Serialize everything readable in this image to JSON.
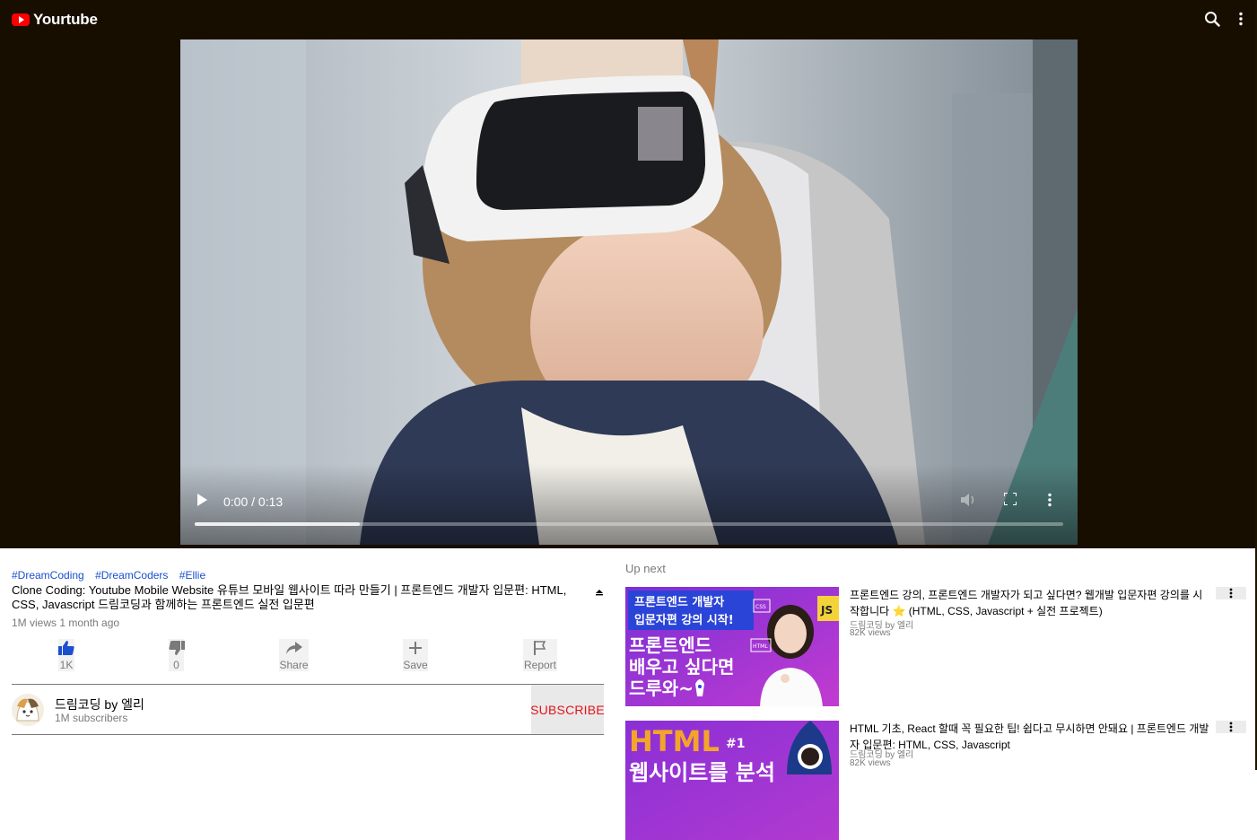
{
  "header": {
    "app_title": "Yourtube",
    "logo_icon": "youtube-play-icon",
    "search_icon": "search-icon",
    "menu_icon": "more-vert-icon",
    "background": "#180e00"
  },
  "player": {
    "time_display": "0:00 / 0:13",
    "progress": 0.19,
    "icons": [
      "play-icon",
      "volume-icon",
      "fullscreen-icon",
      "more-vert-icon"
    ]
  },
  "video_info": {
    "tags": [
      "#DreamCoding",
      "#DreamCoders",
      "#Ellie"
    ],
    "title": "Clone Coding: Youtube Mobile Website 유튜브 모바일 웹사이트 따라 만들기 | 프론트엔드 개발자 입문편: HTML, CSS, Javascript 드림코딩과 함께하는 프론트엔드 실전 입문편",
    "meta": "1M views 1 month ago"
  },
  "actions": {
    "like": "1K",
    "dislike": "0",
    "share": "Share",
    "save": "Save",
    "report": "Report",
    "like_color": "#1a4fd0"
  },
  "channel": {
    "name": "드림코딩 by 엘리",
    "subscribers": "1M subscribers",
    "subscribe_label": "SUBSCRIBE",
    "subscribe_color": "#e2141a"
  },
  "up_next": {
    "heading": "Up next",
    "items": [
      {
        "title": "프론트엔드 강의, 프론트엔드 개발자가 되고 싶다면? 웹개발 입문자편 강의를 시작합니다 ⭐️ (HTML, CSS, Javascript + 실전 프로젝트)",
        "channel": "드림코딩 by 엘리",
        "views": "82K views",
        "thumb_text": {
          "line1": "프론트엔드 개발자",
          "line2": "입문자편 강의 시작!",
          "big1": "프론트엔드",
          "big2": "배우고 싶다면",
          "big3": "드루와~",
          "badge_js": "JS",
          "badge_css": "CSS",
          "badge_html": "HTML"
        }
      },
      {
        "title": "HTML 기초, React 할때 꼭 필요한 팁! 쉽다고 무시하면 안돼요 | 프론트엔드 개발자 입문편: HTML, CSS, Javascript",
        "channel": "드림코딩 by 엘리",
        "views": "82K views",
        "thumb_text": {
          "big1": "HTML",
          "num": "#1",
          "big2": "웹사이트를 분석"
        }
      }
    ]
  }
}
